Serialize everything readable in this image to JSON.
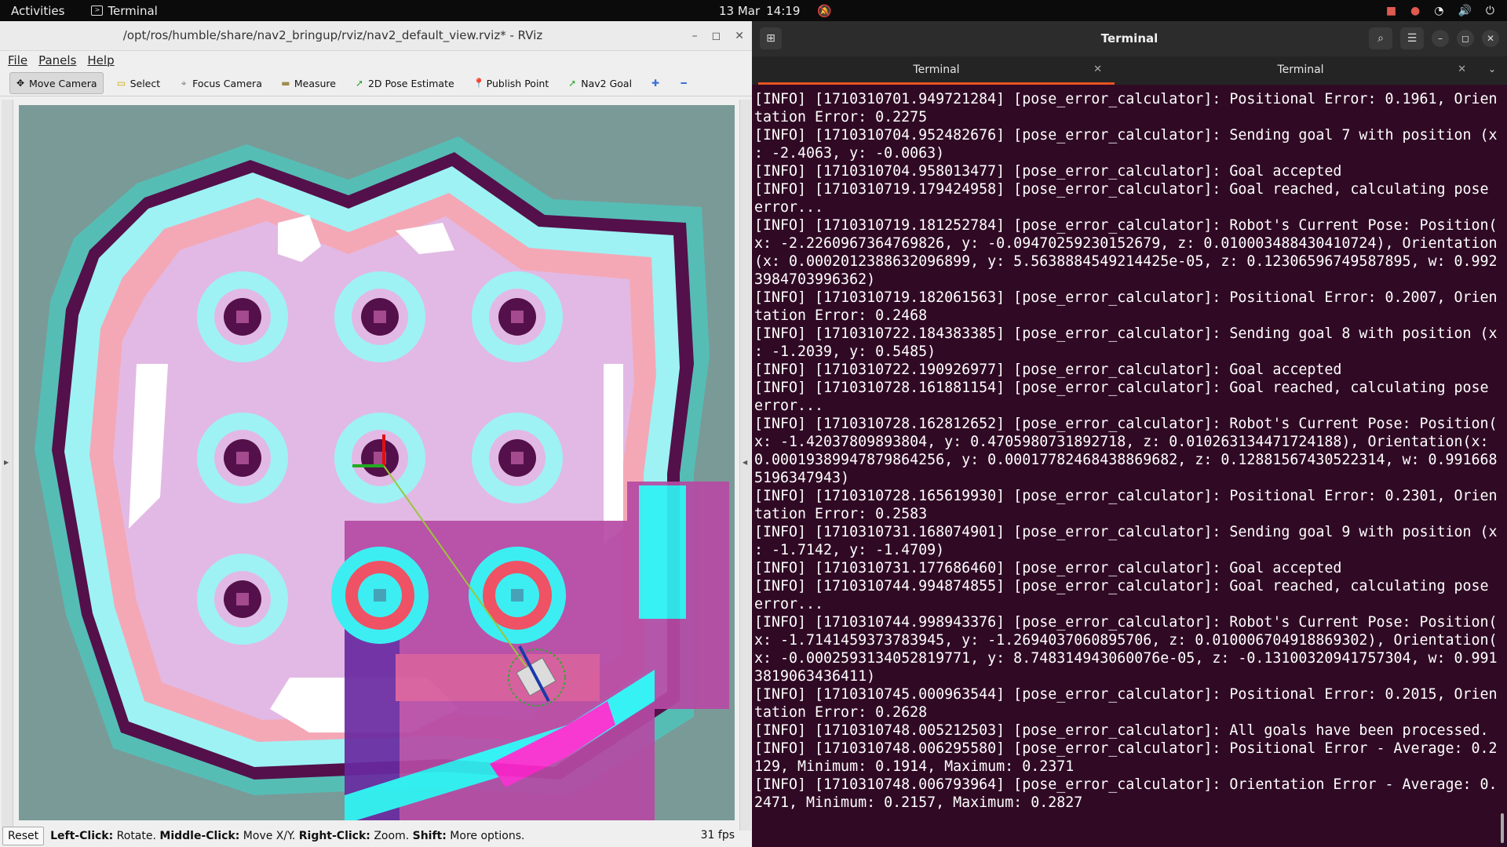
{
  "topbar": {
    "activities": "Activities",
    "app_name": "Terminal",
    "date": "13 Mar",
    "time": "14:19"
  },
  "rviz": {
    "title": "/opt/ros/humble/share/nav2_bringup/rviz/nav2_default_view.rviz* - RViz",
    "menu": [
      "File",
      "Panels",
      "Help"
    ],
    "tools": [
      {
        "label": "Move Camera",
        "icon": "move-camera-icon"
      },
      {
        "label": "Select",
        "icon": "select-icon"
      },
      {
        "label": "Focus Camera",
        "icon": "focus-camera-icon"
      },
      {
        "label": "Measure",
        "icon": "measure-icon"
      },
      {
        "label": "2D Pose Estimate",
        "icon": "pose-estimate-icon"
      },
      {
        "label": "Publish Point",
        "icon": "publish-point-icon"
      },
      {
        "label": "Nav2 Goal",
        "icon": "nav2-goal-icon"
      }
    ],
    "status": {
      "reset": "Reset",
      "hint_left_key": "Left-Click:",
      "hint_left_val": " Rotate. ",
      "hint_mid_key": "Middle-Click:",
      "hint_mid_val": " Move X/Y. ",
      "hint_right_key": "Right-Click:",
      "hint_right_val": " Zoom. ",
      "hint_shift_key": "Shift:",
      "hint_shift_val": " More options.",
      "fps": "31 fps"
    }
  },
  "terminal": {
    "title": "Terminal",
    "tabs": [
      "Terminal",
      "Terminal"
    ],
    "lines": [
      "[INFO] [1710310701.949721284] [pose_error_calculator]: Positional Error: 0.1961, Orien",
      "tation Error: 0.2275",
      "[INFO] [1710310704.952482676] [pose_error_calculator]: Sending goal 7 with position (x",
      ": -2.4063, y: -0.0063)",
      "[INFO] [1710310704.958013477] [pose_error_calculator]: Goal accepted",
      "[INFO] [1710310719.179424958] [pose_error_calculator]: Goal reached, calculating pose",
      "error...",
      "[INFO] [1710310719.181252784] [pose_error_calculator]: Robot's Current Pose: Position(",
      "x: -2.2260967364769826, y: -0.09470259230152679, z: 0.010003488430410724), Orientation",
      "(x: 0.0002012388632096899, y: 5.5638884549214425e-05, z: 0.12306596749587895, w: 0.992",
      "3984703996362)",
      "[INFO] [1710310719.182061563] [pose_error_calculator]: Positional Error: 0.2007, Orien",
      "tation Error: 0.2468",
      "[INFO] [1710310722.184383385] [pose_error_calculator]: Sending goal 8 with position (x",
      ": -1.2039, y: 0.5485)",
      "[INFO] [1710310722.190926977] [pose_error_calculator]: Goal accepted",
      "[INFO] [1710310728.161881154] [pose_error_calculator]: Goal reached, calculating pose",
      "error...",
      "[INFO] [1710310728.162812652] [pose_error_calculator]: Robot's Current Pose: Position(",
      "x: -1.42037809893804, y: 0.4705980731892718, z: 0.010263134471724188), Orientation(x:",
      "0.00019389947879864256, y: 0.00017782468438869682, z: 0.12881567430522314, w: 0.991668",
      "5196347943)",
      "[INFO] [1710310728.165619930] [pose_error_calculator]: Positional Error: 0.2301, Orien",
      "tation Error: 0.2583",
      "[INFO] [1710310731.168074901] [pose_error_calculator]: Sending goal 9 with position (x",
      ": -1.7142, y: -1.4709)",
      "[INFO] [1710310731.177686460] [pose_error_calculator]: Goal accepted",
      "[INFO] [1710310744.994874855] [pose_error_calculator]: Goal reached, calculating pose",
      "error...",
      "[INFO] [1710310744.998943376] [pose_error_calculator]: Robot's Current Pose: Position(",
      "x: -1.7141459373783945, y: -1.2694037060895706, z: 0.010006704918869302), Orientation(",
      "x: -0.0002593134052819771, y: 8.748314943060076e-05, z: -0.13100320941757304, w: 0.991",
      "3819063436411)",
      "[INFO] [1710310745.000963544] [pose_error_calculator]: Positional Error: 0.2015, Orien",
      "tation Error: 0.2628",
      "[INFO] [1710310748.005212503] [pose_error_calculator]: All goals have been processed.",
      "[INFO] [1710310748.006295580] [pose_error_calculator]: Positional Error - Average: 0.2",
      "129, Minimum: 0.1914, Maximum: 0.2371",
      "[INFO] [1710310748.006793964] [pose_error_calculator]: Orientation Error - Average: 0.",
      "2471, Minimum: 0.2157, Maximum: 0.2827"
    ]
  },
  "colors": {
    "terminal_bg": "#300a24",
    "tab_accent": "#e95420",
    "map_unknown": "#7a9a97",
    "map_inscribed": "#5a0e4a",
    "map_inflation_cyan": "#9ef2f4",
    "map_free": "#ffffff"
  }
}
